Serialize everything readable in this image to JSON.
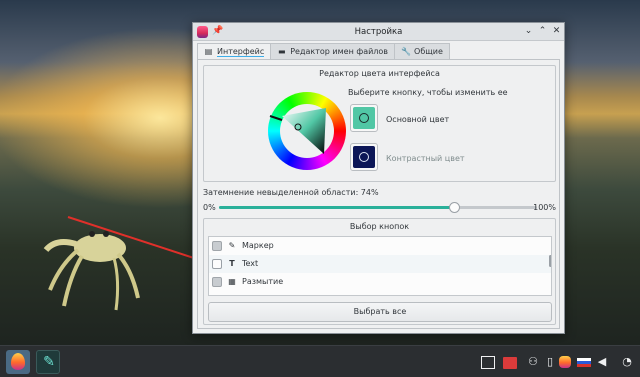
{
  "window": {
    "title": "Настройка",
    "minimize_glyph": "⌄",
    "maximize_glyph": "⌃",
    "close_glyph": "✕",
    "pin_glyph": "📌"
  },
  "tabs": [
    {
      "label": "Интерфейс",
      "icon": "interface-icon",
      "glyph": "▤",
      "active": true
    },
    {
      "label": "Редактор имен файлов",
      "icon": "filename-editor-icon",
      "glyph": "▬",
      "active": false
    },
    {
      "label": "Общие",
      "icon": "wrench-icon",
      "glyph": "🔧",
      "active": false
    }
  ],
  "color_editor": {
    "title": "Редактор цвета интерфейса",
    "hint": "Выберите кнопку, чтобы изменить ее",
    "main_color_label": "Основной цвет",
    "contrast_color_label": "Контрастный цвет",
    "main_color": "#51c7a5",
    "contrast_color": "#0c1657"
  },
  "dimming": {
    "label": "Затемнение невыделенной области: 74%",
    "value": 74,
    "min_label": "0%",
    "max_label": "100%"
  },
  "buttons_group": {
    "title": "Выбор кнопок",
    "items": [
      {
        "label": "Маркер",
        "icon": "marker-icon",
        "glyph": "✎",
        "checked": true
      },
      {
        "label": "Text",
        "icon": "text-icon",
        "glyph": "T",
        "checked": false
      },
      {
        "label": "Размытие",
        "icon": "blur-icon",
        "glyph": "▦",
        "checked": true
      }
    ],
    "select_all_label": "Выбрать все"
  },
  "colors": {
    "accent": "#3daee9",
    "slider_fill": "#2ab09a",
    "arrow": "#e0302a"
  }
}
